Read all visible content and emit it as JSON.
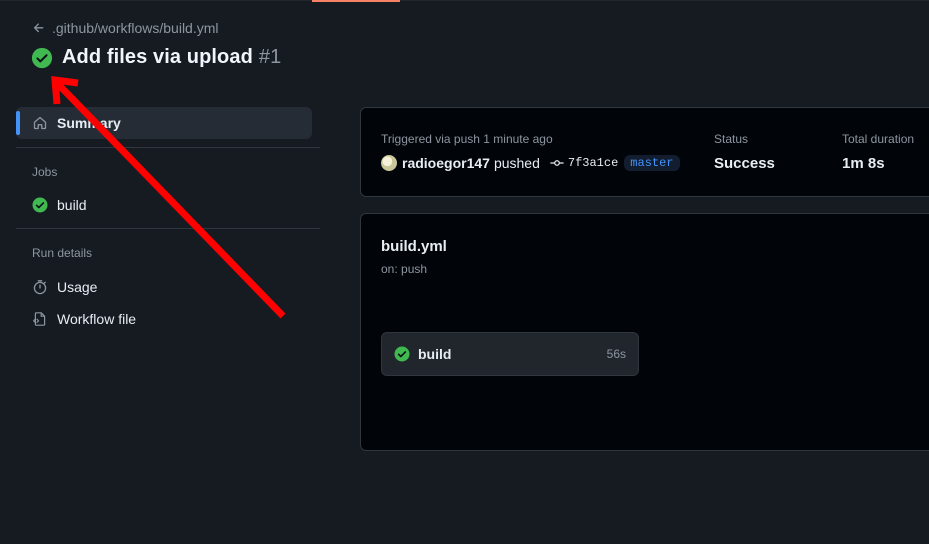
{
  "breadcrumb": {
    "path": ".github/workflows/build.yml"
  },
  "header": {
    "title": "Add files via upload",
    "run_number": "#1"
  },
  "sidebar": {
    "summary_label": "Summary",
    "jobs_heading": "Jobs",
    "jobs": [
      {
        "label": "build",
        "status": "success"
      }
    ],
    "run_details_heading": "Run details",
    "run_details": [
      {
        "label": "Usage",
        "icon": "stopwatch-icon"
      },
      {
        "label": "Workflow file",
        "icon": "file-code-icon"
      }
    ]
  },
  "summary": {
    "trigger_text": "Triggered via push 1 minute ago",
    "actor": "radioegor147",
    "action": "pushed",
    "commit_sha": "7f3a1ce",
    "branch": "master",
    "status_label": "Status",
    "status_value": "Success",
    "duration_label": "Total duration",
    "duration_value": "1m 8s"
  },
  "workflow_graph": {
    "file_name": "build.yml",
    "trigger": "on: push",
    "job": {
      "name": "build",
      "duration": "56s",
      "status": "success"
    }
  },
  "colors": {
    "page_bg": "#161b22",
    "panel_bg": "#010409",
    "success_green": "#3fb950",
    "accent_blue": "#4493f8",
    "annotation_red": "#ff0000"
  }
}
